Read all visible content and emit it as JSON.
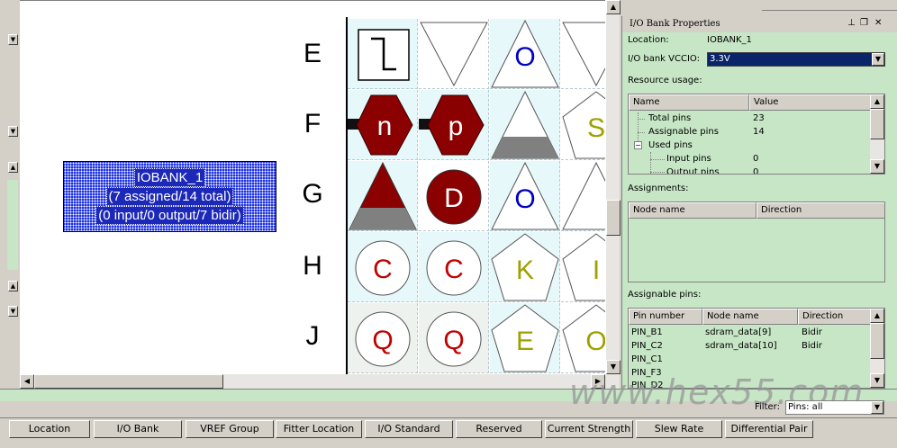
{
  "canvas": {
    "bank_box_lines": [
      "IOBANK_1",
      "(7 assigned/14 total)",
      "(0 input/0 output/7 bidir)"
    ],
    "row_labels": [
      "E",
      "F",
      "G",
      "H",
      "J"
    ],
    "cells": [
      [
        "",
        "",
        "O",
        ""
      ],
      [
        "n",
        "p",
        "",
        "S"
      ],
      [
        "",
        "D",
        "O",
        ""
      ],
      [
        "C",
        "C",
        "K",
        "I"
      ],
      [
        "Q",
        "Q",
        "E",
        "O"
      ]
    ]
  },
  "panel": {
    "title": "I/O Bank Properties",
    "controls": [
      "pin-icon",
      "restore-icon",
      "close-icon"
    ],
    "location_label": "Location:",
    "location_value": "IOBANK_1",
    "vccio_label": "I/O bank VCCIO:",
    "vccio_value": "3.3V",
    "resource_label": "Resource usage:",
    "resource_table": {
      "headers": [
        "Name",
        "Value"
      ],
      "rows": [
        {
          "name": "Total pins",
          "value": "23"
        },
        {
          "name": "Assignable pins",
          "value": "14"
        },
        {
          "name": "Used pins",
          "value": ""
        },
        {
          "name": "Input pins",
          "value": "0"
        },
        {
          "name": "Output pins",
          "value": "0"
        }
      ]
    },
    "assignments_label": "Assignments:",
    "assignments_table": {
      "headers": [
        "Node name",
        "Direction"
      ]
    },
    "assignable_label": "Assignable pins:",
    "assignable_table": {
      "headers": [
        "Pin number",
        "Node name",
        "Direction"
      ],
      "rows": [
        {
          "pin": "PIN_B1",
          "node": "sdram_data[9]",
          "dir": "Bidir"
        },
        {
          "pin": "PIN_C2",
          "node": "sdram_data[10]",
          "dir": "Bidir"
        },
        {
          "pin": "PIN_C1",
          "node": "",
          "dir": ""
        },
        {
          "pin": "PIN_F3",
          "node": "",
          "dir": ""
        },
        {
          "pin": "PIN_D2",
          "node": "",
          "dir": ""
        }
      ]
    },
    "filter_label": "Filter:",
    "filter_value": "Pins: all"
  },
  "watermark": "www.hex55.com",
  "columns": [
    "Location",
    "I/O Bank",
    "VREF Group",
    "Fitter Location",
    "I/O Standard",
    "Reserved",
    "Current Strength",
    "Slew Rate",
    "Differential Pair"
  ],
  "colors": {
    "bank_blue": "#1e32e6",
    "dark_red": "#8b0000",
    "pin_red": "#c00000",
    "pin_blue": "#0000c0",
    "pin_olive": "#a0a000",
    "panel_green": "#c6e6c6",
    "cell_cyan": "#e6f8fa",
    "selection_navy": "#0a246a"
  }
}
